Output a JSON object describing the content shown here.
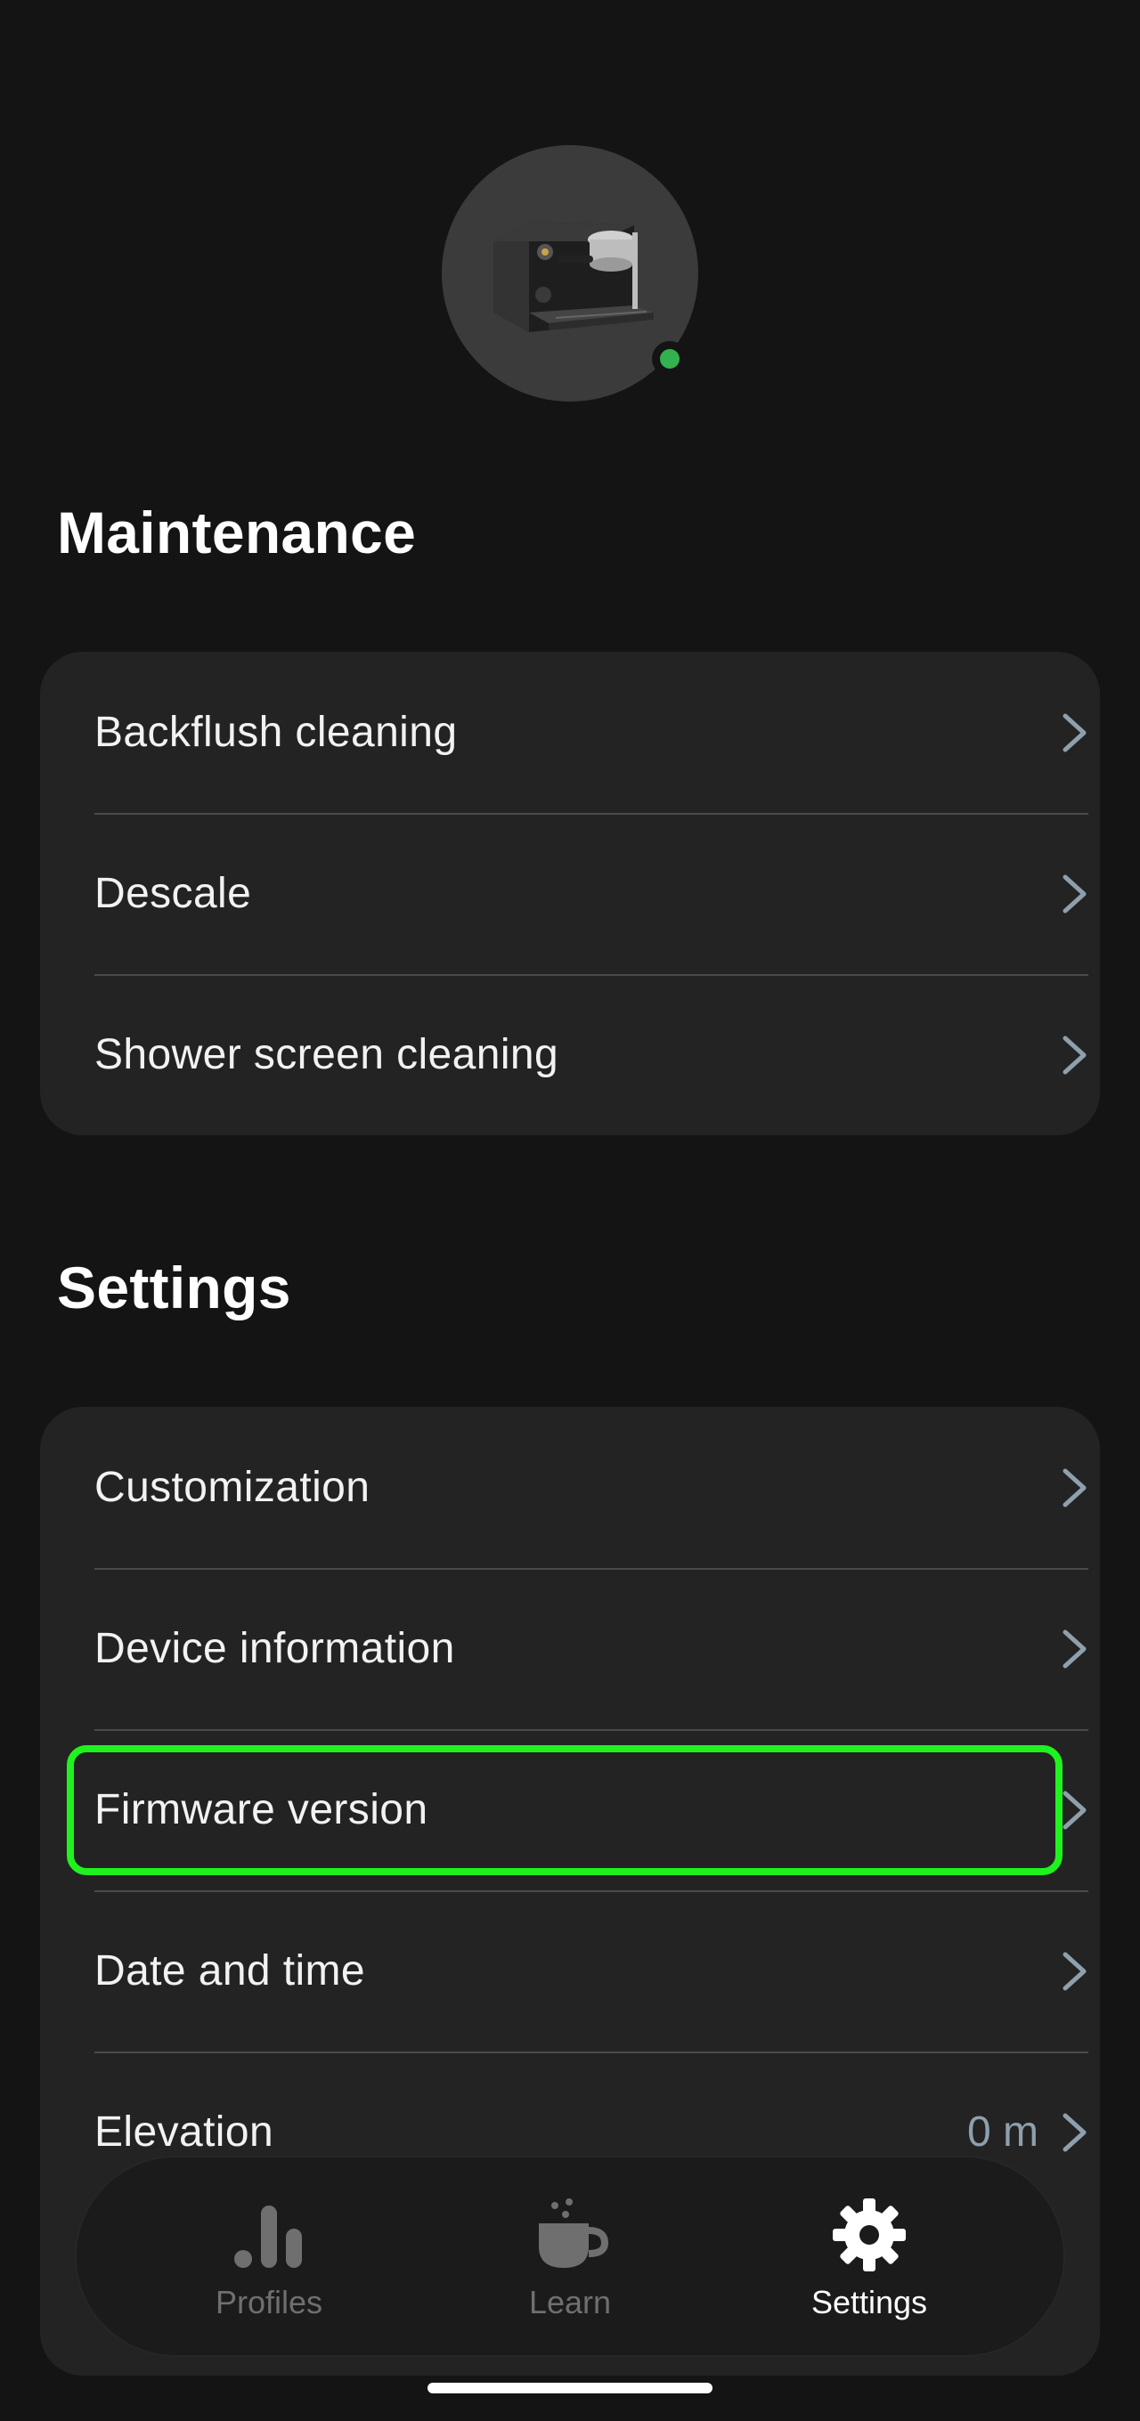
{
  "device": {
    "status_color": "#32b24e",
    "image_icon": "espresso-machine-icon"
  },
  "maintenance": {
    "title": "Maintenance",
    "items": [
      {
        "label": "Backflush cleaning"
      },
      {
        "label": "Descale"
      },
      {
        "label": "Shower screen cleaning"
      }
    ]
  },
  "settings": {
    "title": "Settings",
    "items": [
      {
        "label": "Customization"
      },
      {
        "label": "Device information"
      },
      {
        "label": "Firmware version",
        "highlighted": true
      },
      {
        "label": "Date and time"
      },
      {
        "label": "Elevation",
        "value": "0 m"
      }
    ]
  },
  "bottom_nav": {
    "items": [
      {
        "label": "Profiles",
        "icon": "bar-chart-icon",
        "active": false
      },
      {
        "label": "Learn",
        "icon": "coffee-cup-icon",
        "active": false
      },
      {
        "label": "Settings",
        "icon": "gear-icon",
        "active": true
      }
    ]
  },
  "colors": {
    "background": "#141414",
    "card": "#232323",
    "highlight": "#1ff21f",
    "chevron": "#8ea0ad"
  }
}
